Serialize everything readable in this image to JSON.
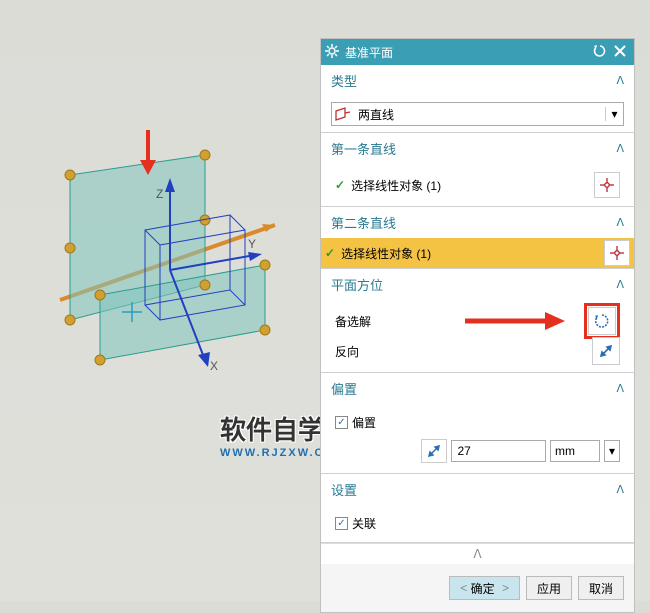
{
  "dialog": {
    "title": "基准平面",
    "type_section": {
      "label": "类型",
      "value": "两直线"
    },
    "line1_section": {
      "label": "第一条直线",
      "row": "选择线性对象 (1)"
    },
    "line2_section": {
      "label": "第二条直线",
      "row": "选择线性对象 (1)"
    },
    "orient_section": {
      "label": "平面方位",
      "alt": "备选解",
      "reverse": "反向"
    },
    "offset_section": {
      "label": "偏置",
      "chk": "偏置",
      "value": "27",
      "unit": "mm"
    },
    "settings_section": {
      "label": "设置",
      "chk": "关联"
    }
  },
  "footer": {
    "ok": "确定",
    "apply": "应用",
    "cancel": "取消"
  },
  "axes": {
    "x": "X",
    "y": "Y",
    "z": "Z"
  },
  "watermark": {
    "cn": "软件自学网",
    "en": "WWW.RJZXW.COM"
  }
}
